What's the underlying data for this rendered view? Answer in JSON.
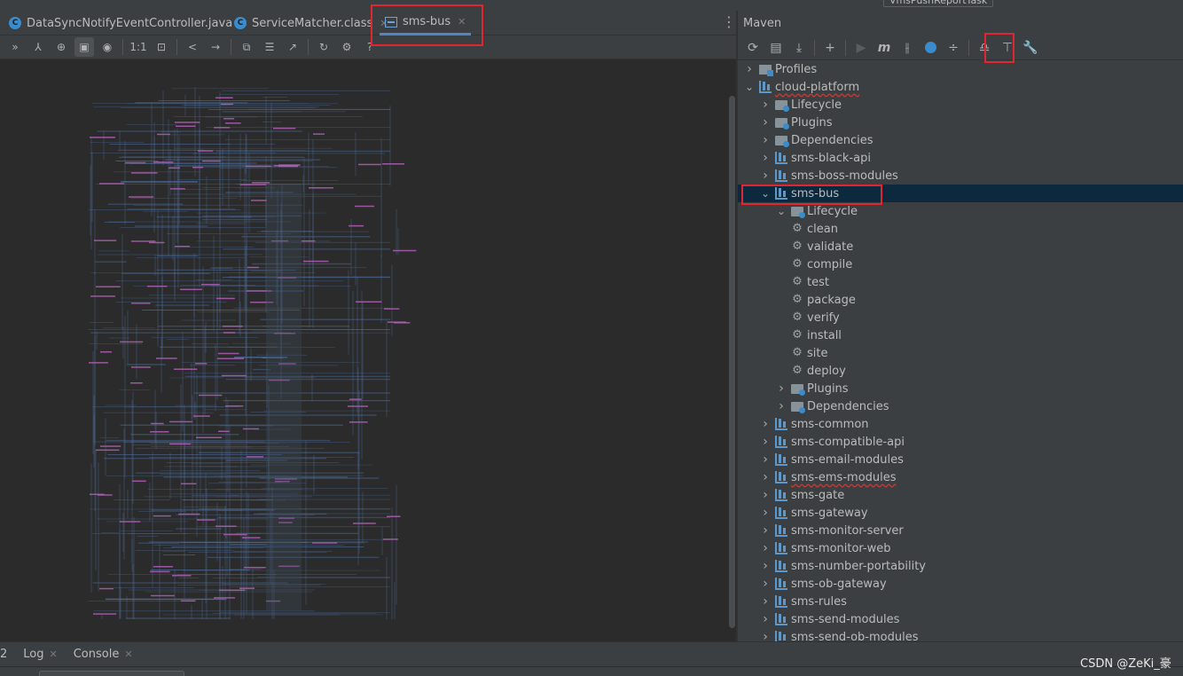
{
  "top_strip": {
    "run_config": "VmsPushReportTask"
  },
  "editor_tabs": [
    {
      "label": "DataSyncNotifyEventController.java",
      "icon": "class-icon",
      "close": "✕"
    },
    {
      "label": "ServiceMatcher.class",
      "icon": "class-icon",
      "close": "✕"
    },
    {
      "label": "sms-bus",
      "icon": "diagram-icon",
      "close": "✕"
    }
  ],
  "diagram_toolbar": {
    "actual_size_label": "1:1",
    "help_label": "?"
  },
  "maven": {
    "title": "Maven",
    "tree": [
      {
        "label": "Profiles",
        "level": 0,
        "expanded": false,
        "icon": "profiles-icon"
      },
      {
        "label": "cloud-platform",
        "level": 0,
        "expanded": true,
        "icon": "module-icon",
        "squiggle": true
      },
      {
        "label": "Lifecycle",
        "level": 1,
        "expanded": false,
        "icon": "folder-icon"
      },
      {
        "label": "Plugins",
        "level": 1,
        "expanded": false,
        "icon": "folder-icon"
      },
      {
        "label": "Dependencies",
        "level": 1,
        "expanded": false,
        "icon": "dependencies-icon"
      },
      {
        "label": "sms-black-api",
        "level": 1,
        "expanded": false,
        "icon": "module-icon"
      },
      {
        "label": "sms-boss-modules",
        "level": 1,
        "expanded": false,
        "icon": "module-icon"
      },
      {
        "label": "sms-bus",
        "level": 1,
        "expanded": true,
        "icon": "module-icon",
        "selected": true
      },
      {
        "label": "Lifecycle",
        "level": 2,
        "expanded": true,
        "icon": "folder-icon"
      },
      {
        "label": "clean",
        "level": 3,
        "leaf": true,
        "icon": "gear-icon"
      },
      {
        "label": "validate",
        "level": 3,
        "leaf": true,
        "icon": "gear-icon"
      },
      {
        "label": "compile",
        "level": 3,
        "leaf": true,
        "icon": "gear-icon"
      },
      {
        "label": "test",
        "level": 3,
        "leaf": true,
        "icon": "gear-icon"
      },
      {
        "label": "package",
        "level": 3,
        "leaf": true,
        "icon": "gear-icon"
      },
      {
        "label": "verify",
        "level": 3,
        "leaf": true,
        "icon": "gear-icon"
      },
      {
        "label": "install",
        "level": 3,
        "leaf": true,
        "icon": "gear-icon"
      },
      {
        "label": "site",
        "level": 3,
        "leaf": true,
        "icon": "gear-icon"
      },
      {
        "label": "deploy",
        "level": 3,
        "leaf": true,
        "icon": "gear-icon"
      },
      {
        "label": "Plugins",
        "level": 2,
        "expanded": false,
        "icon": "folder-icon"
      },
      {
        "label": "Dependencies",
        "level": 2,
        "expanded": false,
        "icon": "dependencies-icon"
      },
      {
        "label": "sms-common",
        "level": 1,
        "expanded": false,
        "icon": "module-icon"
      },
      {
        "label": "sms-compatible-api",
        "level": 1,
        "expanded": false,
        "icon": "module-icon"
      },
      {
        "label": "sms-email-modules",
        "level": 1,
        "expanded": false,
        "icon": "module-icon"
      },
      {
        "label": "sms-ems-modules",
        "level": 1,
        "expanded": false,
        "icon": "module-icon",
        "squiggle": true
      },
      {
        "label": "sms-gate",
        "level": 1,
        "expanded": false,
        "icon": "module-icon"
      },
      {
        "label": "sms-gateway",
        "level": 1,
        "expanded": false,
        "icon": "module-icon"
      },
      {
        "label": "sms-monitor-server",
        "level": 1,
        "expanded": false,
        "icon": "module-icon"
      },
      {
        "label": "sms-monitor-web",
        "level": 1,
        "expanded": false,
        "icon": "module-icon"
      },
      {
        "label": "sms-number-portability",
        "level": 1,
        "expanded": false,
        "icon": "module-icon"
      },
      {
        "label": "sms-ob-gateway",
        "level": 1,
        "expanded": false,
        "icon": "module-icon"
      },
      {
        "label": "sms-rules",
        "level": 1,
        "expanded": false,
        "icon": "module-icon"
      },
      {
        "label": "sms-send-modules",
        "level": 1,
        "expanded": false,
        "icon": "module-icon"
      },
      {
        "label": "sms-send-ob-modules",
        "level": 1,
        "expanded": false,
        "icon": "module-icon"
      }
    ]
  },
  "bottom_tabs": {
    "partial_label": "2",
    "log_label": "Log",
    "console_label": "Console",
    "close": "✕"
  },
  "watermark": "CSDN @ZeKi_豪",
  "colors": {
    "accent": "#4a88c7",
    "highlight": "#e0262f",
    "selection": "#0d293e",
    "diagram_edge": "#4d6e9e",
    "diagram_label": "#b05fb5"
  }
}
